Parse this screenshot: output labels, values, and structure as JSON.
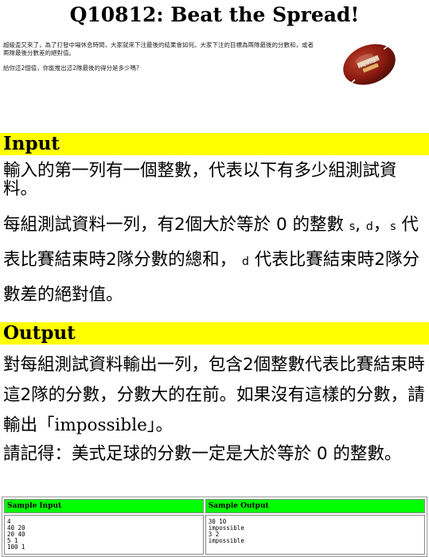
{
  "title": "Q10812: Beat the Spread!",
  "intro": {
    "para1": "超級盃又來了，為了打發中場休息時間，大家就來下注最後的結果會如何。大家下注的目標為兩隊最後的分數和，或者兩隊最後分數差的絕對值。",
    "para2": "給你這2個值，你能推出這2隊最後的得分是多少嗎?"
  },
  "football": {
    "label": "SPALDING J5V",
    "color": "#8b1a10"
  },
  "input_section": {
    "heading": "Input",
    "line1": "輸入的第一列有一個整數，代表以下有多少組測試資料。",
    "line2a": "每組測試資料一列，有2個大於等於 0 的整數",
    "var_s": "s",
    "comma": ",",
    "var_d": "d",
    "line2b": "，",
    "var_s2": "s",
    "line2c": "代表比賽結束時2隊分數的總和，",
    "var_d2": "d",
    "line2d": "代表比賽結束時2隊分數差的絕對值。"
  },
  "output_section": {
    "heading": "Output",
    "line1a": "對每組測試資料輸出一列，包含2個整數代表比賽結束時這2隊的分數，分數大的在前。如果沒有這樣的分數，請輸出「",
    "impossible": "impossible",
    "line1b": "」。",
    "line2": "請記得：美式足球的分數一定是大於等於 0 的整數。"
  },
  "samples": {
    "input_header": "Sample Input",
    "output_header": "Sample Output",
    "input_text": "4\n40 20\n20 40\n5 1\n100 1",
    "output_text": "30 10\nimpossible\n3 2\nimpossible"
  },
  "colors": {
    "section_bg": "#ffff00",
    "sample_header_bg": "#00ff00"
  }
}
